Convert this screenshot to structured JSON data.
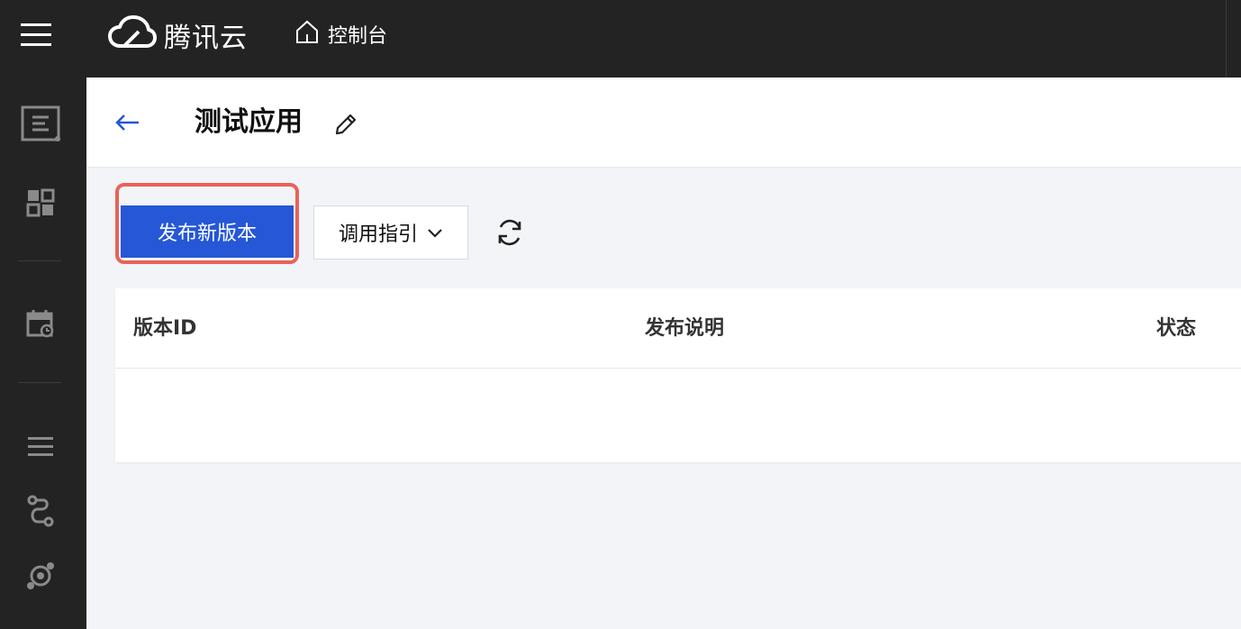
{
  "brand": {
    "name": "腾讯云"
  },
  "nav": {
    "console": "控制台"
  },
  "header": {
    "title": "测试应用"
  },
  "toolbar": {
    "publish": "发布新版本",
    "guide": "调用指引"
  },
  "table": {
    "columns": [
      "版本ID",
      "发布说明",
      "状态"
    ]
  },
  "colors": {
    "topbar": "#232323",
    "primary": "#2557d6",
    "highlight": "#e8625b",
    "back_arrow": "#2557d6"
  }
}
